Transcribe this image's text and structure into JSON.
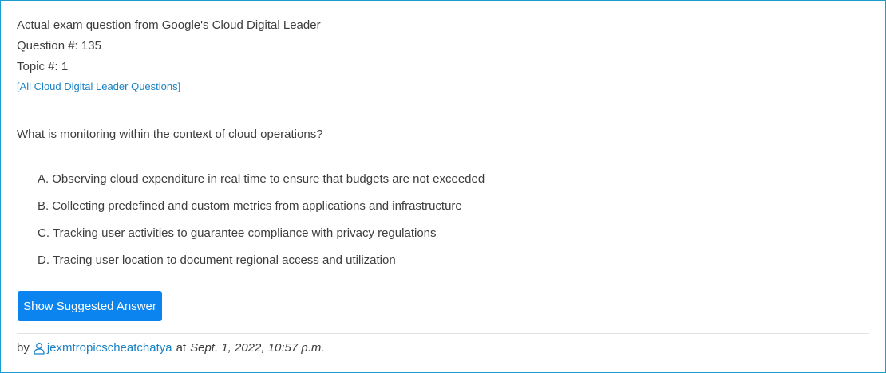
{
  "header": {
    "exam_line": "Actual exam question from Google's Cloud Digital Leader",
    "question_number": "Question #: 135",
    "topic_number": "Topic #: 1",
    "all_questions_link": "[All Cloud Digital Leader Questions]"
  },
  "question": {
    "text": "What is monitoring within the context of cloud operations?",
    "choices": [
      {
        "letter": "A.",
        "text": "Observing cloud expenditure in real time to ensure that budgets are not exceeded"
      },
      {
        "letter": "B.",
        "text": "Collecting predefined and custom metrics from applications and infrastructure"
      },
      {
        "letter": "C.",
        "text": "Tracking user activities to guarantee compliance with privacy regulations"
      },
      {
        "letter": "D.",
        "text": "Tracing user location to document regional access and utilization"
      }
    ]
  },
  "actions": {
    "show_answer_label": "Show Suggested Answer"
  },
  "byline": {
    "by": "by",
    "user_icon": "user-outline-icon",
    "username": "jexmtropicscheatchatya",
    "at": "at",
    "date": "Sept. 1, 2022, 10:57 p.m."
  },
  "colors": {
    "accent": "#1a9bd0",
    "link": "#1a82c4",
    "button": "#0c84f0"
  }
}
